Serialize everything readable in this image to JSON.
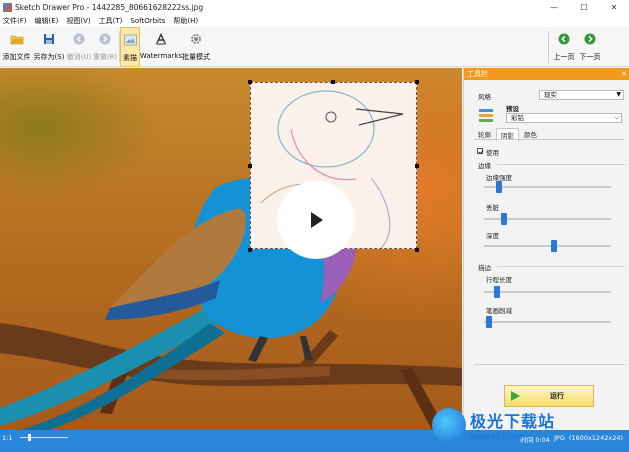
{
  "window": {
    "title": "Sketch Drawer Pro - 1442285_80661628222ss.jpg",
    "minimize": "—",
    "maximize": "☐",
    "close": "✕"
  },
  "menu": [
    "文件(F)",
    "编辑(E)",
    "视图(V)",
    "工具(T)",
    "SoftOrbits",
    "帮助(H)"
  ],
  "toolbar": {
    "add_file": "添加文件",
    "save_as": "另存为(S)",
    "undo": "撤消(U)",
    "redo": "重做(R)",
    "sketch": "素描",
    "watermarks": "Watermarks",
    "batch": "批量模式",
    "prev": "上一页",
    "next": "下一页"
  },
  "panel": {
    "title": "工具栏",
    "close": "✕",
    "style_label": "风格",
    "style_value": "现实",
    "preset_label": "预设",
    "preset_value": "彩铅",
    "tabs": [
      "轮廓",
      "阴影",
      "颜色"
    ],
    "use_label": "使用",
    "edges_group": "边缘",
    "edge_strength_label": "边缘强度",
    "edge_strength": 0.1,
    "sharpness_label": "丢脏",
    "sharpness": 0.14,
    "tone_label": "深度",
    "tone": 0.55,
    "stroke_group": "描边",
    "stroke_length_label": "行程长度",
    "stroke_length": 0.08,
    "stroke_width_label": "笔画削减",
    "stroke_width": 0.02,
    "run_label": "运行"
  },
  "status": {
    "zoom": "1:1",
    "time": "时间 0:04",
    "format": "JPG",
    "size": "(1600x1242x24)"
  },
  "watermark": {
    "cn": "极光下载站",
    "url": "www.xz7.com"
  },
  "colors": {
    "accent": "#f39a1e",
    "statusbar": "#2a86d8",
    "slider": "#2b78d4"
  }
}
